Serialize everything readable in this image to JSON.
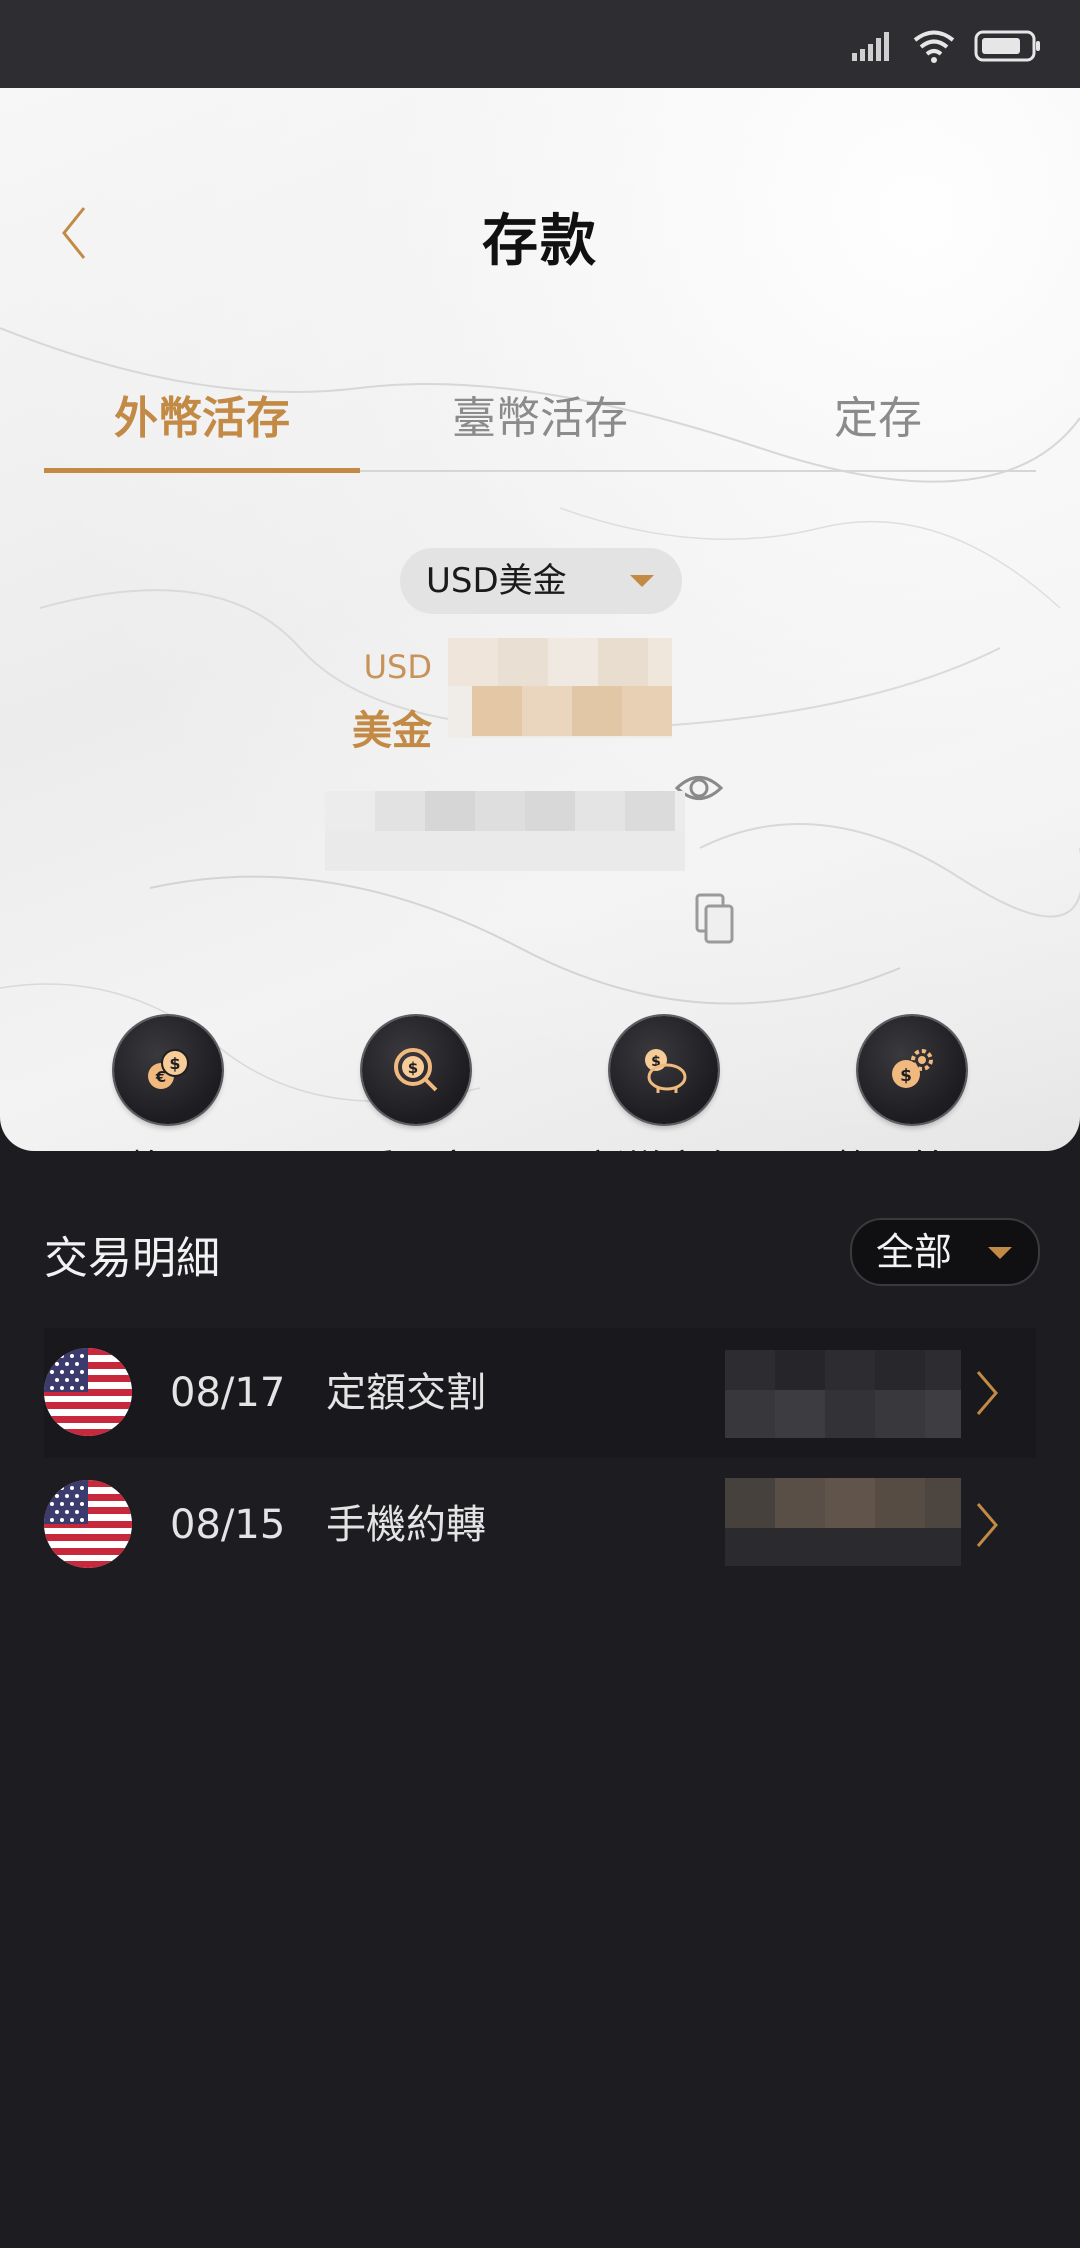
{
  "header": {
    "title": "存款"
  },
  "tabs": [
    {
      "label": "外幣活存"
    },
    {
      "label": "臺幣活存"
    },
    {
      "label": "定存"
    }
  ],
  "currency_select": {
    "value": "USD美金"
  },
  "balance": {
    "code": "USD",
    "name": "美金"
  },
  "actions": [
    {
      "label": "換匯",
      "icon": "exchange-icon"
    },
    {
      "label": "看匯率",
      "icon": "rate-search-icon"
    },
    {
      "label": "新增定存",
      "icon": "piggy-bank-icon"
    },
    {
      "label": "換匯管理",
      "icon": "exchange-settings-icon"
    }
  ],
  "transactions": {
    "title": "交易明細",
    "filter": "全部",
    "rows": [
      {
        "date": "08/17",
        "desc": "定額交割"
      },
      {
        "date": "08/15",
        "desc": "手機約轉"
      }
    ]
  },
  "colors": {
    "accent": "#c28a45",
    "dark_bg": "#1d1c21"
  }
}
